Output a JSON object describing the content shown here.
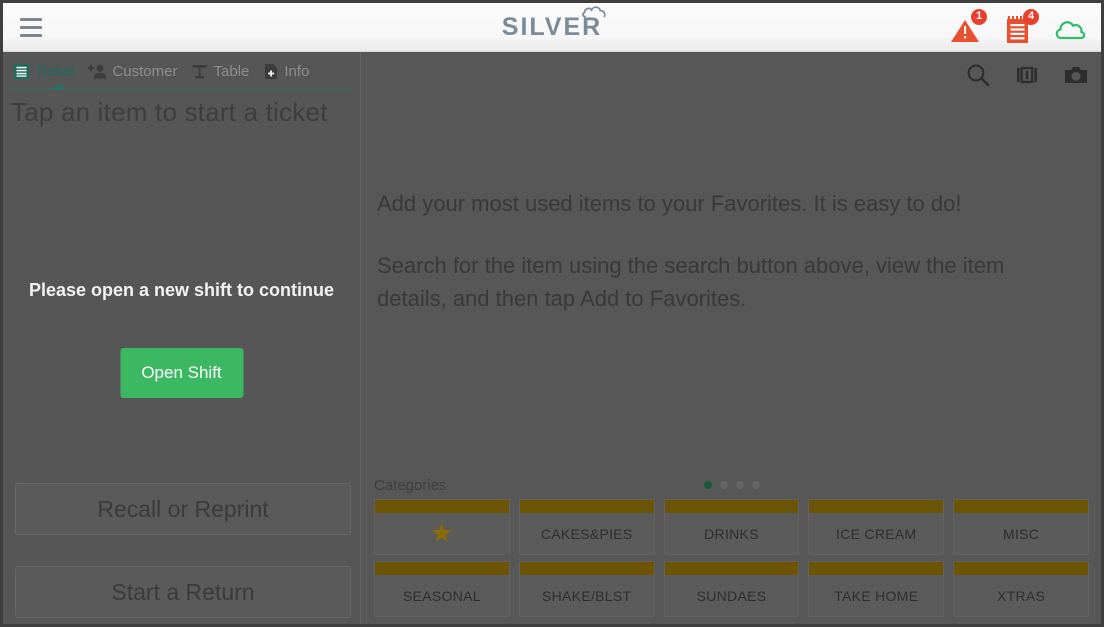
{
  "header": {
    "menu_icon": "hamburger-menu-icon",
    "logo_text": "SILVER",
    "logo_mark": "cloud-outline-icon",
    "icons": [
      {
        "name": "alert-warning-icon",
        "badge": "1",
        "color": "#e8502f"
      },
      {
        "name": "open-orders-receipt-icon",
        "badge": "4",
        "color": "#e8502f"
      },
      {
        "name": "cloud-sync-icon",
        "badge": "",
        "color": "#2fbd6b"
      }
    ]
  },
  "left_panel": {
    "tabs": [
      {
        "label": "Ticket",
        "icon": "ticket-list-icon",
        "active": true
      },
      {
        "label": "Customer",
        "icon": "add-person-icon",
        "active": false
      },
      {
        "label": "Table",
        "icon": "table-icon",
        "active": false
      },
      {
        "label": "Info",
        "icon": "info-document-icon",
        "active": false
      }
    ],
    "tap_hint": "Tap an item to start a ticket",
    "shift_message": "Please open a new shift to continue",
    "open_shift_label": "Open Shift",
    "open_shift_color": "#3cb863",
    "recall_label": "Recall or Reprint",
    "return_label": "Start a Return"
  },
  "right_panel": {
    "toolbar_icons": [
      {
        "name": "search-icon"
      },
      {
        "name": "barcode-scan-icon"
      },
      {
        "name": "camera-icon"
      }
    ],
    "help_paragraph_1": "Add your most used items to your Favorites. It is easy to do!",
    "help_paragraph_2": "Search for the item using the search button above, view the item details, and then tap Add to Favorites.",
    "categories_label": "Categories",
    "page_dots": {
      "count": 4,
      "active_index": 0,
      "active_color": "#1a5b3d"
    },
    "category_stripe_color": "#6b5505",
    "categories": [
      {
        "label": "",
        "icon": "favorites-star-icon"
      },
      {
        "label": "CAKES&PIES",
        "icon": ""
      },
      {
        "label": "DRINKS",
        "icon": ""
      },
      {
        "label": "ICE CREAM",
        "icon": ""
      },
      {
        "label": "MISC",
        "icon": ""
      },
      {
        "label": "SEASONAL",
        "icon": ""
      },
      {
        "label": "SHAKE/BLST",
        "icon": ""
      },
      {
        "label": "SUNDAES",
        "icon": ""
      },
      {
        "label": "TAKE HOME",
        "icon": ""
      },
      {
        "label": "XTRAS",
        "icon": ""
      }
    ]
  }
}
